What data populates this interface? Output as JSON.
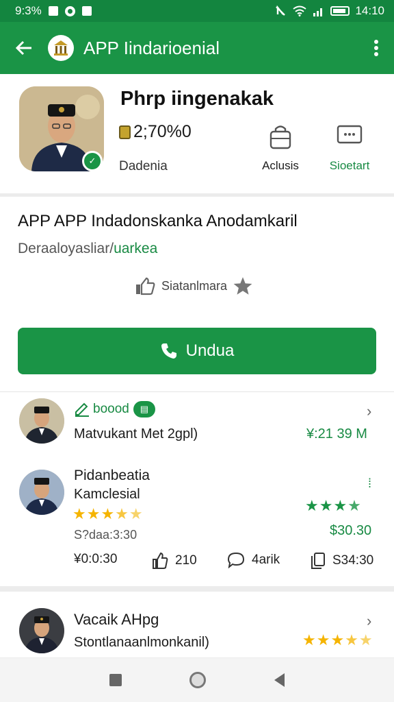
{
  "status_bar": {
    "time": "9:3%",
    "clock": "14:10"
  },
  "app_bar": {
    "title": "APP Iindarioenial"
  },
  "profile": {
    "name": "Phrp iingenakak",
    "balance": "2;70%0",
    "subtitle": "Dadenia",
    "actions": [
      {
        "label": "Aclusis"
      },
      {
        "label": "Sioetart"
      }
    ]
  },
  "detail": {
    "title": "APP APP Indadonskanka Anodamkaril",
    "subtitle_plain": "Deraaloyasliar/",
    "subtitle_accent": "uarkea",
    "rating_label": "Siatanlmara",
    "download_label": "Undua"
  },
  "list": [
    {
      "tag": "boood",
      "name": "Matvukant Met 2gpl)",
      "price": "¥:21 39 M"
    },
    {
      "name": "Pidanbeatia",
      "sub": "Kamclesial",
      "meta": "S?daa:3:30",
      "price": "$30.30",
      "stars_main": 3.5,
      "stars_side": 3.5,
      "stats": [
        {
          "icon": "clock-icon",
          "value": "¥0:0:30"
        },
        {
          "icon": "thumbs-up-icon",
          "value": "210"
        },
        {
          "icon": "comment-icon",
          "value": "4arik"
        },
        {
          "icon": "copy-icon",
          "value": "S34:30"
        }
      ]
    },
    {
      "name": "Vacaik AHpg",
      "sub": "Stontlanaanlmonkanil)",
      "stars": 3.5
    }
  ],
  "colors": {
    "primary": "#1a9446",
    "status_bar": "#13853f",
    "star": "#f5b400",
    "accent_text": "#188a43"
  }
}
